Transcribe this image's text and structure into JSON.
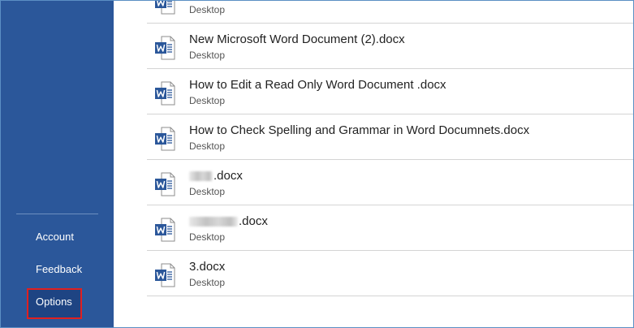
{
  "sidebar": {
    "items": [
      {
        "label": "Account"
      },
      {
        "label": "Feedback"
      },
      {
        "label": "Options",
        "highlighted": true
      }
    ]
  },
  "documents": [
    {
      "name": "",
      "location": "Desktop",
      "icon": "word-document-icon"
    },
    {
      "name": "New Microsoft Word Document (2).docx",
      "location": "Desktop",
      "icon": "word-document-icon"
    },
    {
      "name": "How to Edit a Read Only Word Document .docx",
      "location": "Desktop",
      "icon": "word-document-icon"
    },
    {
      "name": "How to Check Spelling and Grammar in Word Documnets.docx",
      "location": "Desktop",
      "icon": "word-document-icon"
    },
    {
      "name": ".docx",
      "location": "Desktop",
      "icon": "word-document-icon",
      "name_prefix_obscured": true
    },
    {
      "name": ".docx",
      "location": "Desktop",
      "icon": "word-document-icon",
      "name_prefix_obscured": true
    },
    {
      "name": "3.docx",
      "location": "Desktop",
      "icon": "word-document-icon"
    }
  ],
  "colors": {
    "sidebar_background": "#2b579a",
    "selected_highlight": "#e02020",
    "word_icon_blue": "#2b579a"
  }
}
